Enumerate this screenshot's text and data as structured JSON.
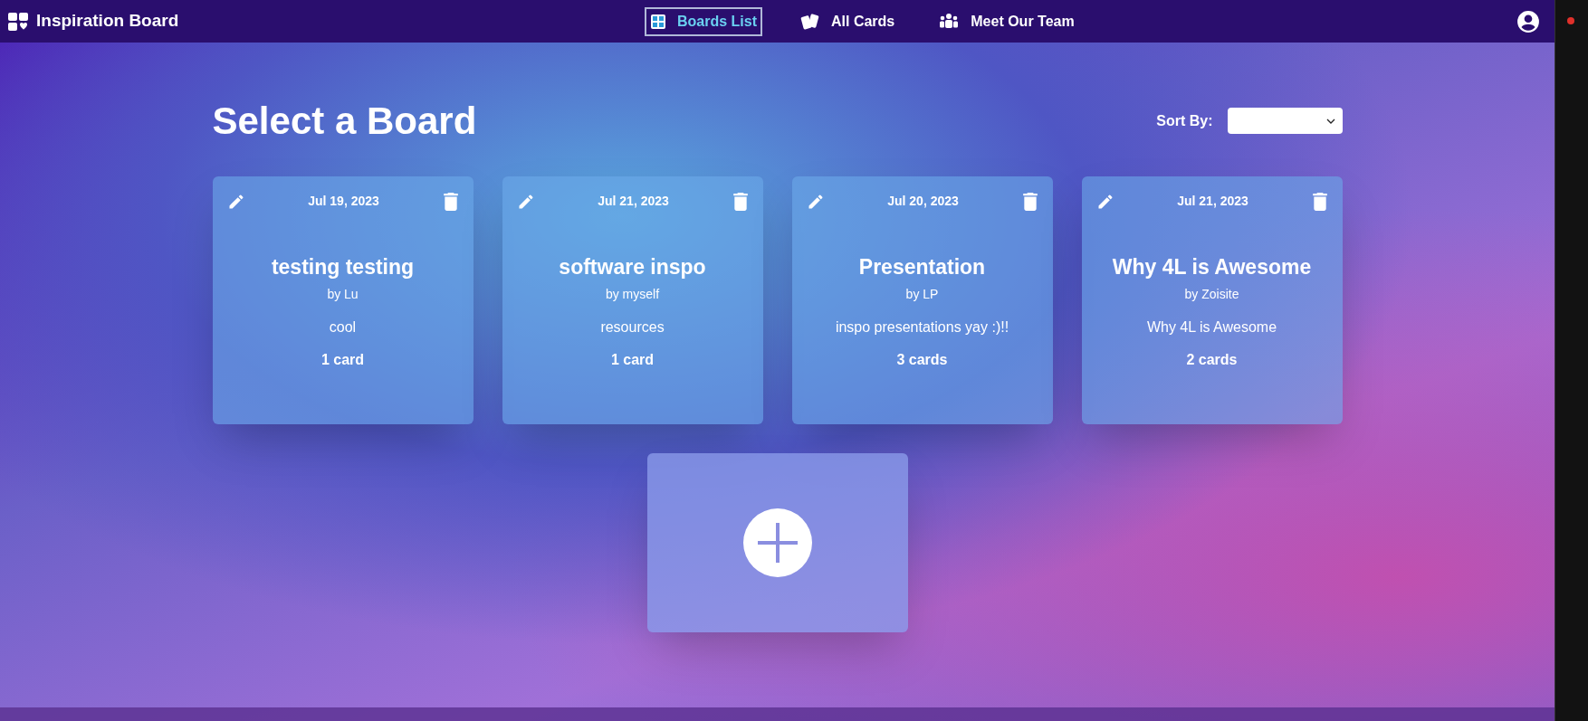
{
  "app": {
    "title": "Inspiration Board"
  },
  "nav": [
    {
      "label": "Boards List",
      "kind": "grid",
      "selected": true
    },
    {
      "label": "All Cards",
      "kind": "cards",
      "selected": false
    },
    {
      "label": "Meet Our Team",
      "kind": "team",
      "selected": false
    }
  ],
  "heading": "Select a Board",
  "sort": {
    "label": "Sort By:"
  },
  "boards": [
    {
      "date": "Jul 19, 2023",
      "title": "testing testing",
      "owner": "by Lu",
      "description": "cool",
      "count": "1 card"
    },
    {
      "date": "Jul 21, 2023",
      "title": "software inspo",
      "owner": "by myself",
      "description": "resources",
      "count": "1 card"
    },
    {
      "date": "Jul 20, 2023",
      "title": "Presentation",
      "owner": "by LP",
      "description": "inspo presentations yay :)!!",
      "count": "3 cards"
    },
    {
      "date": "Jul 21, 2023",
      "title": "Why 4L is Awesome",
      "owner": "by Zoisite",
      "description": "Why 4L is Awesome",
      "count": "2 cards"
    }
  ]
}
